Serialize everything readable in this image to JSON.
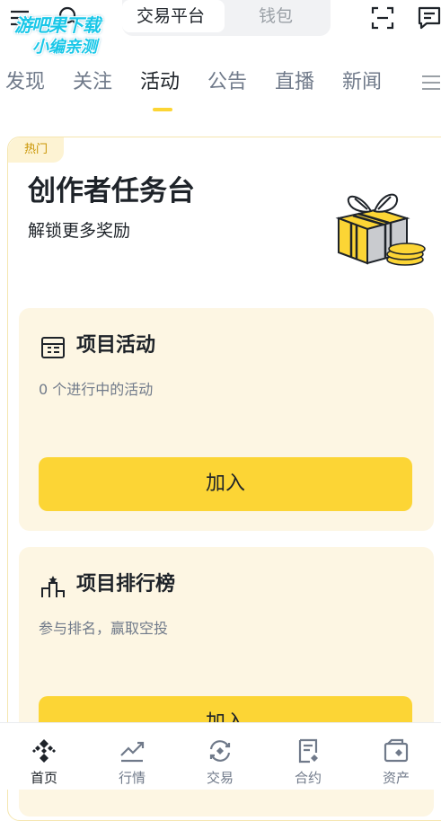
{
  "header": {
    "segment": {
      "active": "交易平台",
      "inactive": "钱包"
    }
  },
  "watermark": {
    "line1": "游吧果下载",
    "line2": "小编亲测"
  },
  "tabs": [
    {
      "label": "发现"
    },
    {
      "label": "关注"
    },
    {
      "label": "活动",
      "active": true
    },
    {
      "label": "公告"
    },
    {
      "label": "直播"
    },
    {
      "label": "新闻"
    }
  ],
  "card": {
    "badge": "热门",
    "title": "创作者任务台",
    "subtitle": "解锁更多奖励",
    "panels": [
      {
        "title": "项目活动",
        "desc": "0 个进行中的活动",
        "button": "加入",
        "icon": "calendar-icon"
      },
      {
        "title": "项目排行榜",
        "desc": "参与排名，赢取空投",
        "button": "加入",
        "icon": "podium-icon"
      }
    ]
  },
  "bottom_nav": [
    {
      "label": "首页",
      "icon": "home-icon",
      "active": true
    },
    {
      "label": "行情",
      "icon": "chart-icon"
    },
    {
      "label": "交易",
      "icon": "trade-icon"
    },
    {
      "label": "合约",
      "icon": "contract-icon"
    },
    {
      "label": "资产",
      "icon": "wallet-icon"
    }
  ],
  "colors": {
    "accent": "#fcd535",
    "panel_bg": "#fdf6e3",
    "text": "#1e2329",
    "muted": "#707a8a"
  }
}
